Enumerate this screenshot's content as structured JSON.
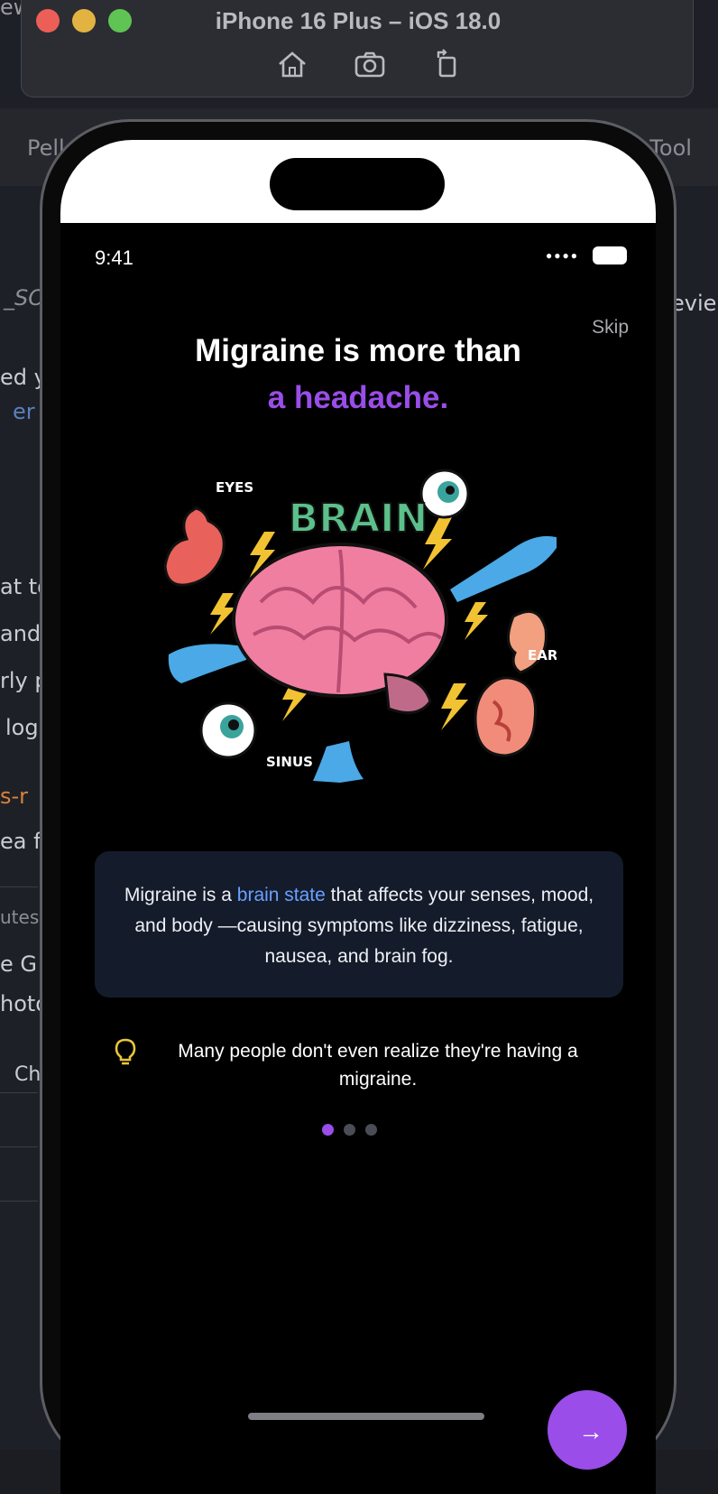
{
  "simulator": {
    "title": "iPhone 16 Plus – iOS 18.0",
    "toolbar": [
      "home-icon",
      "screenshot-icon",
      "rotate-icon"
    ]
  },
  "background": {
    "left_fragments": [
      "ew",
      "Pell",
      "_SO",
      "ed y",
      "er",
      "at to",
      "and",
      "rly p",
      "log",
      "s-r",
      "ea f",
      "utes",
      "e G",
      "hoto",
      "Ch"
    ],
    "right_fragments": [
      "l Tool",
      "evie"
    ]
  },
  "status_bar": {
    "time": "9:41"
  },
  "onboarding": {
    "skip_label": "Skip",
    "headline_line1": "Migraine is more than",
    "headline_line2": "a headache.",
    "illustration_labels": {
      "title": "BRAIN",
      "eyes": "EYES",
      "ears": "EARS",
      "sinus": "SINUS"
    },
    "card_pre": "Migraine is a ",
    "card_highlight": "brain state",
    "card_post": " that affects your senses, mood, and body —causing symptoms like dizziness, fatigue, nausea, and brain fog.",
    "tip_text": "Many people don't even realize they're having a migraine.",
    "page_count": 3,
    "active_page": 1,
    "next_label": "→"
  },
  "colors": {
    "accent": "#9a4de8",
    "highlight": "#6aa0ff",
    "card_bg": "#141b2b",
    "tip_icon": "#e8c53a"
  }
}
